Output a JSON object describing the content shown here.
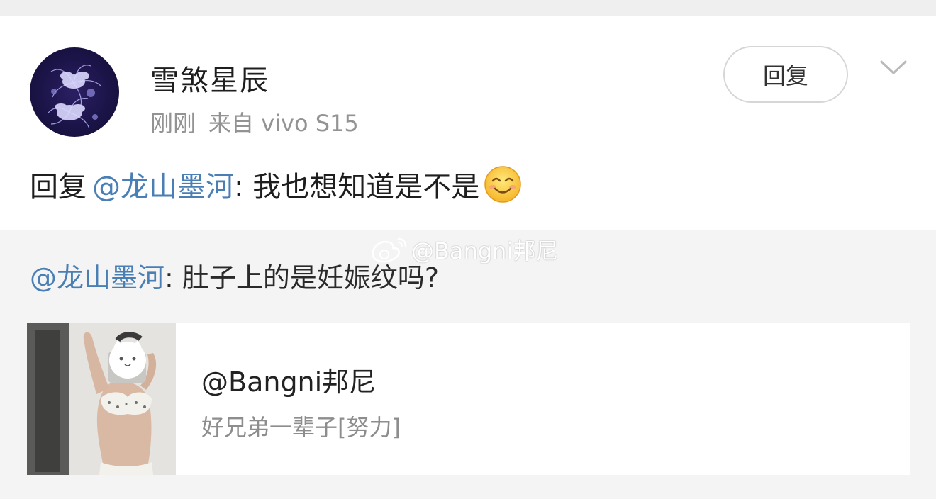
{
  "post": {
    "username": "雪煞星辰",
    "time": "刚刚",
    "source": "来自 vivo S15",
    "reply_button_label": "回复",
    "reply": {
      "prefix": "回复",
      "mention": "@龙山墨河",
      "body": ": 我也想知道是不是",
      "emoji": "smile-emoji"
    }
  },
  "quoted": {
    "mention": "@龙山墨河",
    "body": ": 肚子上的是妊娠纹吗?",
    "watermark": "@Bangni邦尼"
  },
  "card": {
    "title": "@Bangni邦尼",
    "subtitle": "好兄弟一辈子[努力]"
  },
  "colors": {
    "mention": "#4a7fb5",
    "quoted_bg": "#f4f4f4",
    "meta_text": "#939393"
  }
}
